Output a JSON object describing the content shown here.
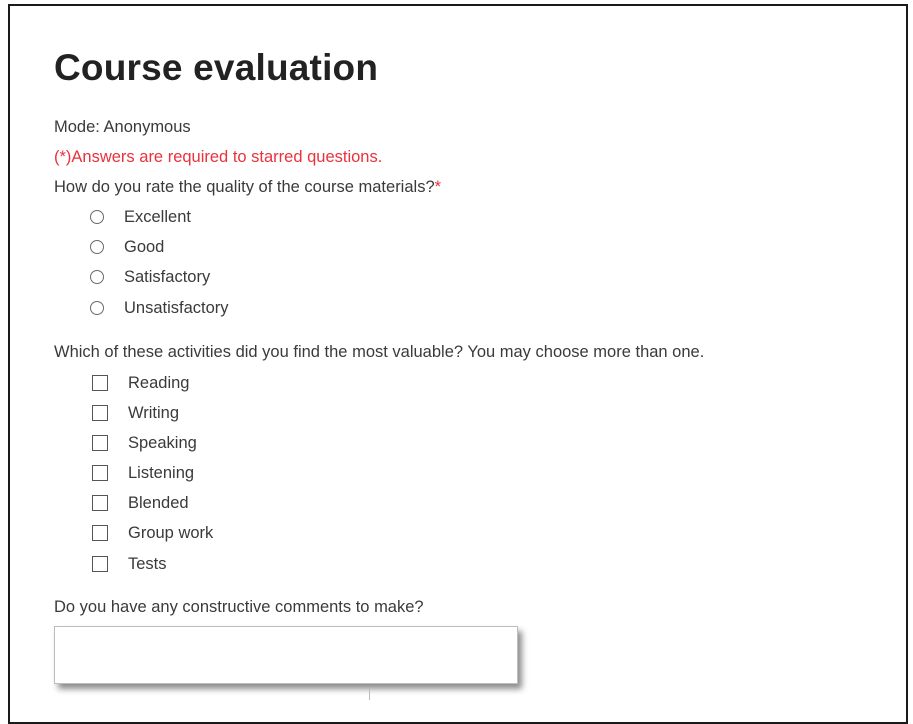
{
  "title": "Course evaluation",
  "mode_text": "Mode: Anonymous",
  "required_note": "(*)Answers are required to starred questions.",
  "q1": {
    "text": "How do you rate the quality of the course materials?",
    "required_mark": "*",
    "options": [
      "Excellent",
      "Good",
      "Satisfactory",
      "Unsatisfactory"
    ]
  },
  "q2": {
    "text": "Which of these activities did you find the most valuable? You may choose more than one.",
    "options": [
      "Reading",
      "Writing",
      "Speaking",
      "Listening",
      "Blended",
      "Group work",
      "Tests"
    ]
  },
  "q3": {
    "text": "Do you have any constructive comments to make?",
    "value": ""
  },
  "colors": {
    "required": "#e8323c",
    "text": "#3a3a3a",
    "frame_border": "#1a1a1a"
  }
}
